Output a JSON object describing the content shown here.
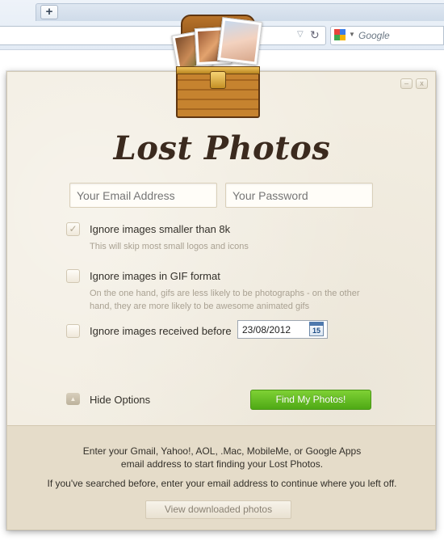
{
  "browser": {
    "new_tab_label": "+",
    "search_placeholder": "Google"
  },
  "app": {
    "title": "Lost Photos",
    "window_min": "–",
    "window_close": "x"
  },
  "form": {
    "email_placeholder": "Your Email Address",
    "password_placeholder": "Your Password"
  },
  "options": [
    {
      "label": "Ignore images smaller than 8k",
      "description": "This will skip most small logos and icons",
      "checked": true
    },
    {
      "label": "Ignore images in GIF format",
      "description_line1": "On the one hand, gifs are less likely to be photographs - on the other",
      "description_line2": "hand, they are more likely to be awesome animated gifs",
      "checked": false
    },
    {
      "label": "Ignore images received before",
      "checked": false
    }
  ],
  "date_value": "23/08/2012",
  "calendar_day": "15",
  "hide_options_label": "Hide Options",
  "find_button": "Find My Photos!",
  "footer": {
    "line1": "Enter your Gmail, Yahoo!, AOL, .Mac, MobileMe, or Google Apps",
    "line2": "email address to start finding your Lost Photos.",
    "line3": "If you've searched before, enter your email address to continue where you left off.",
    "view_button": "View downloaded photos"
  },
  "colors": {
    "accent_green": "#5cb81e",
    "panel_bg": "#f2ede1",
    "footer_bg": "#e5dcc9"
  }
}
